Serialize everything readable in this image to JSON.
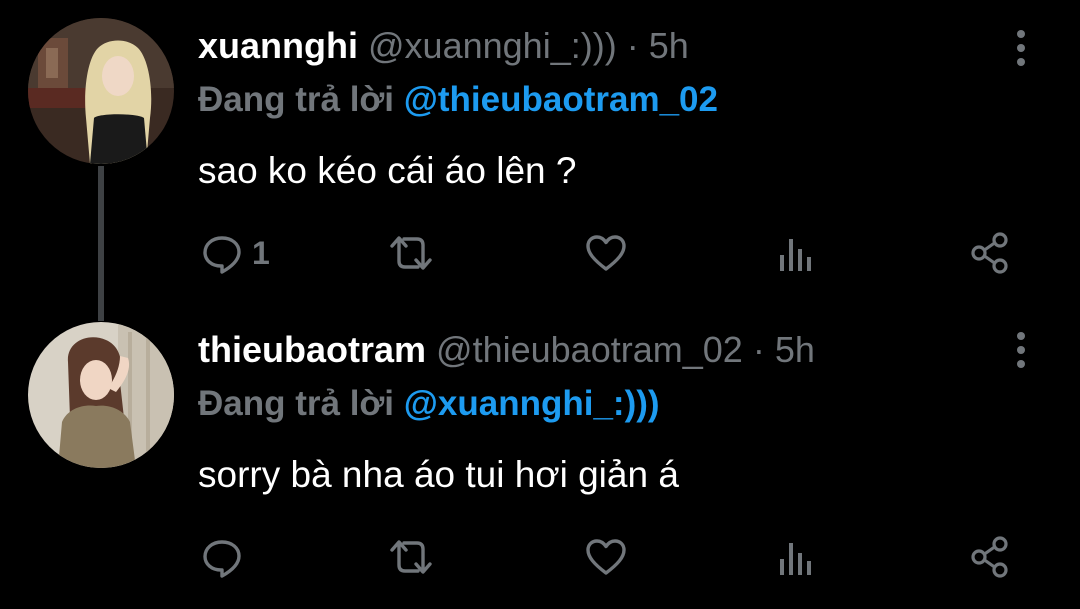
{
  "tweets": [
    {
      "display_name": "xuannghi",
      "handle": "@xuannghi_:)))",
      "separator": "·",
      "time": "5h",
      "replying_prefix": "Đang trả lời",
      "replying_to": "@thieubaotram_02",
      "text": "sao ko kéo cái áo lên ?",
      "reply_count": "1",
      "retweet_count": "",
      "like_count": ""
    },
    {
      "display_name": "thieubaotram",
      "handle": "@thieubaotram_02",
      "separator": "·",
      "time": "5h",
      "replying_prefix": "Đang trả lời",
      "replying_to": "@xuannghi_:)))",
      "text": "sorry bà nha áo tui hơi giản á",
      "reply_count": "",
      "retweet_count": "",
      "like_count": ""
    }
  ],
  "icons": {
    "reply": "reply-icon",
    "retweet": "retweet-icon",
    "like": "heart-icon",
    "views": "views-icon",
    "share": "share-icon",
    "more": "more-vertical-icon"
  },
  "colors": {
    "background": "#000000",
    "primary_text": "#ffffff",
    "secondary_text": "#71767b",
    "accent": "#1d9bf0",
    "thread_line": "#3e4144"
  }
}
